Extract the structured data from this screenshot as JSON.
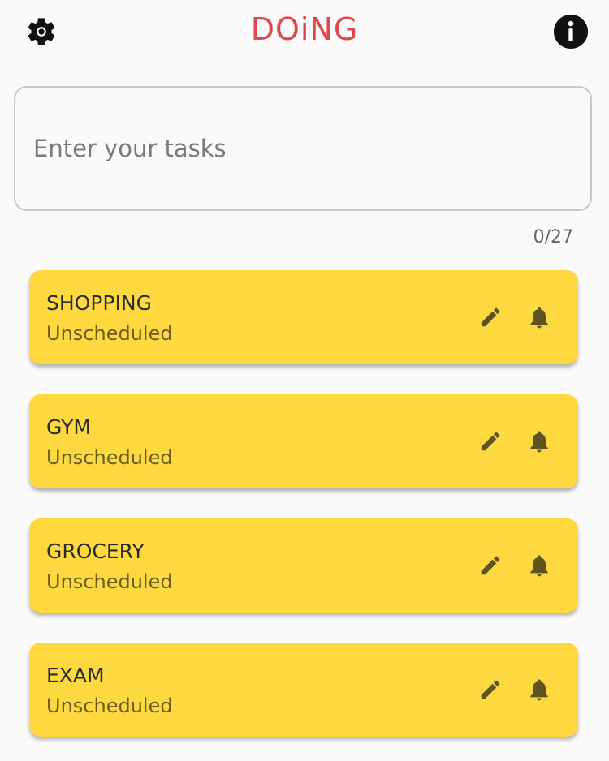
{
  "header": {
    "title": "DOiNG",
    "settings_icon": "gear-icon",
    "info_icon": "info-icon",
    "title_color": "#e0474c"
  },
  "input": {
    "placeholder": "Enter your tasks",
    "value": "",
    "counter": "0/27"
  },
  "card_color": "#fdd83f",
  "tasks": [
    {
      "title": "SHOPPING",
      "status": "Unscheduled"
    },
    {
      "title": "GYM",
      "status": "Unscheduled"
    },
    {
      "title": "GROCERY",
      "status": "Unscheduled"
    },
    {
      "title": "EXAM",
      "status": "Unscheduled"
    }
  ],
  "card_actions": {
    "edit_icon": "pencil-icon",
    "reminder_icon": "bell-icon"
  }
}
